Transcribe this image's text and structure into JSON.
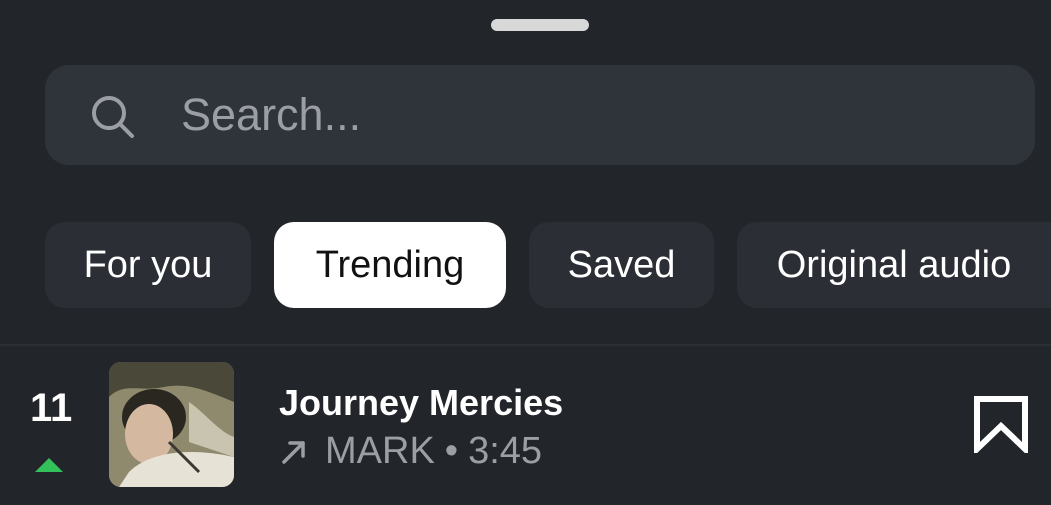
{
  "search": {
    "placeholder": "Search..."
  },
  "tabs": [
    {
      "label": "For you",
      "active": false
    },
    {
      "label": "Trending",
      "active": true
    },
    {
      "label": "Saved",
      "active": false
    },
    {
      "label": "Original audio",
      "active": false
    }
  ],
  "track": {
    "rank": "11",
    "rank_change": "up",
    "title": "Journey Mercies",
    "artist": "MARK",
    "separator": "•",
    "duration": "3:45",
    "trend_icon": "arrow-up-right-icon",
    "bookmark_icon": "bookmark-icon"
  },
  "colors": {
    "background": "#22252a",
    "accent_up": "#33c25a"
  }
}
